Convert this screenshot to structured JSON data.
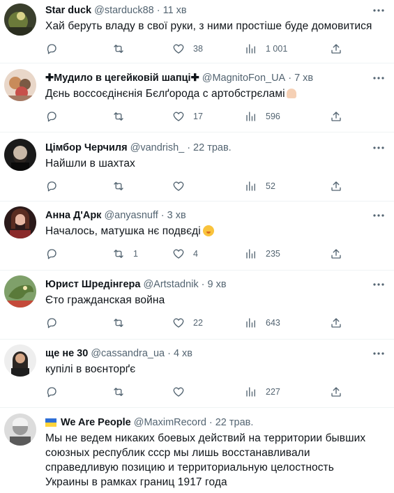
{
  "tweets": [
    {
      "name": "Star duck",
      "handle": "@starduck88",
      "time": "11 хв",
      "text": "Хай беруть владу в свої руки, з ними простіше буде домовитися",
      "replies": "",
      "retweets": "",
      "likes": "38",
      "views": "1 001"
    },
    {
      "name_prefix": "✚",
      "name": "Мудило в цегейковій шапці",
      "name_suffix": "✚",
      "handle": "@MagnitoFon_UA",
      "time": "7 хв",
      "text": "Дєнь воссоєдінєнія Бєлґорода с артобстрєламі",
      "emoji": "flexed-biceps",
      "replies": "",
      "retweets": "",
      "likes": "17",
      "views": "596"
    },
    {
      "name": "Цімбор Черчиля",
      "handle": "@vandrish_",
      "time": "22 трав.",
      "text": "Найшли в шахтах",
      "replies": "",
      "retweets": "",
      "likes": "",
      "views": "52"
    },
    {
      "name": "Анна Д'Арк",
      "handle": "@anyasnuff",
      "time": "3 хв",
      "text": "Началось, матушка нє подвєді",
      "emoji": "hand-over-mouth-face",
      "replies": "",
      "retweets": "1",
      "likes": "4",
      "views": "235"
    },
    {
      "name": "Юрист Шредінгера",
      "handle": "@Artstadnik",
      "time": "9 хв",
      "text": "Єто гражданская война",
      "replies": "",
      "retweets": "",
      "likes": "22",
      "views": "643"
    },
    {
      "name": "ще не 30",
      "handle": "@cassandra_ua",
      "time": "4 хв",
      "text": "купілі в воєнторґє",
      "replies": "",
      "retweets": "",
      "likes": "",
      "views": "227"
    },
    {
      "name": "We Are People",
      "name_flag": "ukraine-flag",
      "handle": "@MaximRecord",
      "time": "22 трав.",
      "text": "Мы не ведем никаких боевых действий на территории бывших союзных республик ссср мы лишь восстанавливали справедливую позицию и территориальную целостность Украины в рамках границ 1917 года"
    }
  ],
  "dot": "·",
  "colors": {
    "text": "#0f1419",
    "secondary": "#536471",
    "divider": "#eff3f4"
  },
  "icons": [
    "reply-icon",
    "retweet-icon",
    "like-icon",
    "views-icon",
    "share-icon",
    "more-icon"
  ]
}
